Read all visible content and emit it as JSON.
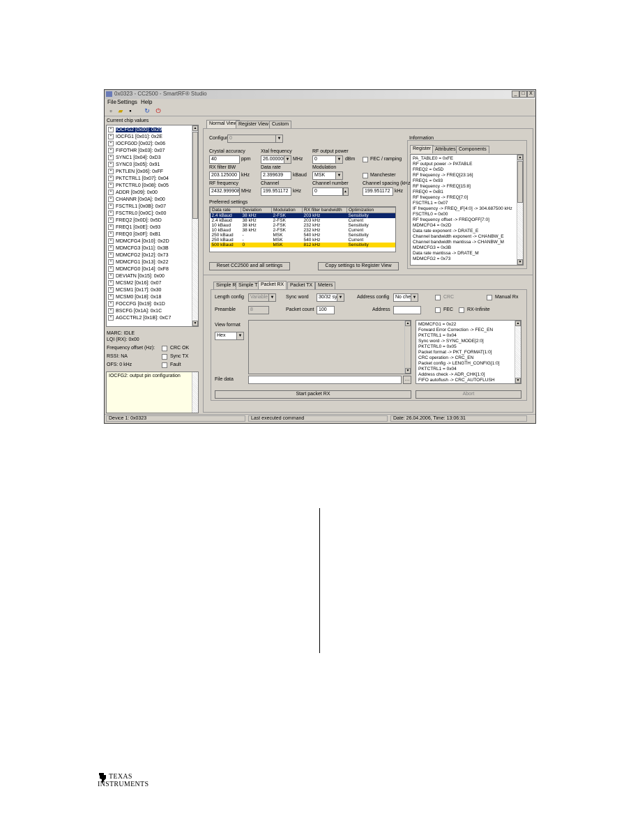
{
  "window": {
    "title": "0x0323 - CC2500 - SmartRF® Studio",
    "min": "_",
    "max": "□",
    "close": "X"
  },
  "menu": [
    "File",
    "Settings",
    "Help"
  ],
  "left": {
    "caption": "Current chip values",
    "tree": [
      "IOCFG2 [0x00]: 0x29",
      "IOCFG1 [0x01]: 0x2E",
      "IOCFG0D [0x02]: 0x06",
      "FIFOTHR [0x03]: 0x07",
      "SYNC1 [0x04]: 0xD3",
      "SYNC0 [0x05]: 0x91",
      "PKTLEN [0x06]: 0xFF",
      "PKTCTRL1 [0x07]: 0x04",
      "PKTCTRL0 [0x08]: 0x05",
      "ADDR [0x09]: 0x00",
      "CHANNR [0x0A]: 0x00",
      "FSCTRL1 [0x0B]: 0x07",
      "FSCTRL0 [0x0C]: 0x00",
      "FREQ2 [0x0D]: 0x5D",
      "FREQ1 [0x0E]: 0x93",
      "FREQ0 [0x0F]: 0xB1",
      "MDMCFG4 [0x10]: 0x2D",
      "MDMCFG3 [0x11]: 0x3B",
      "MDMCFG2 [0x12]: 0x73",
      "MDMCFG1 [0x13]: 0x22",
      "MDMCFG0 [0x14]: 0xF8",
      "DEVIATN [0x15]: 0x00",
      "MCSM2 [0x16]: 0x07",
      "MCSM1 [0x17]: 0x30",
      "MCSM0 [0x18]: 0x18",
      "FOCCFG [0x19]: 0x1D",
      "BSCFG [0x1A]: 0x1C",
      "AGCCTRL2 [0x1B]: 0xC7"
    ],
    "marc": "MARC: IDLE",
    "lqi": "LQI (RX): 0x00",
    "freq_label": "Frequency offset (Hz):",
    "crc_ok": "CRC OK",
    "rssi": "RSSI: NA",
    "sync_tx": "Sync TX",
    "ofs": "OFS: 0 kHz",
    "fault": "Fault",
    "desc": "IOCFG2: output pin configuration"
  },
  "tabs_top": [
    "Normal View",
    "Register View",
    "Custom"
  ],
  "normal": {
    "config_label": "Configuration",
    "config_value": "0",
    "xtal_accuracy_label": "Crystal accuracy",
    "xtal_accuracy": "40",
    "xtal_accuracy_unit": "ppm",
    "xtal_freq_label": "Xtal frequency",
    "xtal_freq": "26.000000",
    "xtal_freq_unit": "MHz",
    "rf_output_label": "RF output power",
    "rf_output": "0",
    "rf_output_unit": "dBm",
    "fec_label": "FEC / ramping",
    "rx_filter_label": "RX filter BW",
    "rx_filter": "203.125000",
    "rx_filter_unit": "kHz",
    "datarate_label": "Data rate",
    "datarate": "2.399639",
    "datarate_unit": "kBaud",
    "modulation_label": "Modulation",
    "modulation": "MSK",
    "manchester_label": "Manchester",
    "freq_label": "RF frequency",
    "freq": "2432.999908",
    "freq_unit": "MHz",
    "channel_label": "Channel",
    "channel": "199.951172",
    "channel_unit": "kHz",
    "channel_number_label": "Channel number",
    "channel_number": "0",
    "chan_spacing_label": "Channel spacing (kHz)",
    "chan_spacing": "199.951172",
    "chan_spacing_unit": "kHz",
    "pref_label": "Preferred settings",
    "pref_headers": [
      "Data rate",
      "Deviation",
      "Modulation",
      "RX filter bandwidth",
      "Optimization"
    ],
    "pref_rows": [
      [
        "2.4 kBaud",
        "38 kHz",
        "2-FSK",
        "203 kHz",
        "Sensitivity"
      ],
      [
        "2.4 kBaud",
        "38 kHz",
        "2-FSK",
        "203 kHz",
        "Current"
      ],
      [
        "10 kBaud",
        "38 kHz",
        "2-FSK",
        "232 kHz",
        "Sensitivity"
      ],
      [
        "10 kBaud",
        "38 kHz",
        "2-FSK",
        "232 kHz",
        "Current"
      ],
      [
        "250 kBaud",
        "-",
        "MSK",
        "540 kHz",
        "Sensitivity"
      ],
      [
        "250 kBaud",
        "-",
        "MSK",
        "540 kHz",
        "Current"
      ],
      [
        "500 kBaud",
        "0",
        "MSK",
        "812 kHz",
        "Sensitivity"
      ]
    ],
    "reset_btn": "Reset CC2500 and all settings",
    "copy_btn": "Copy settings to Register View"
  },
  "info": {
    "caption": "Information",
    "tabs": [
      "Register",
      "Attributes",
      "Components"
    ],
    "lines": [
      "PA_TABLE0 = 0xFE",
      "  RF output power -> PATABLE",
      "FREQ2 = 0x5D",
      "  RF frequency -> FREQ[23:16]",
      "FREQ1 = 0x93",
      "  RF frequency -> FREQ[15:8]",
      "FREQ0 = 0xB1",
      "  RF frequency -> FREQ[7:0]",
      "FSCTRL1 = 0x07",
      "  IF frequency -> FREQ_IF[4:0] -> 304.687500 kHz",
      "FSCTRL0 = 0x00",
      "  RF frequency offset -> FREQOFF[7:0]",
      "MDMCFG4 = 0x2D",
      "  Data rate exponent -> DRATE_E",
      "  Channel bandwidth exponent -> CHANBW_E",
      "  Channel bandwidth mantissa -> CHANBW_M",
      "MDMCFG3 = 0x3B",
      "  Data rate mantissa -> DRATE_M",
      "MDMCFG2 = 0x73"
    ]
  },
  "bottom": {
    "tabs": [
      "Simple RX",
      "Simple TX",
      "Packet RX",
      "Packet TX",
      "Meters"
    ],
    "length_config_label": "Length config",
    "length_config": "Variable",
    "sync_word_label": "Sync word",
    "sync_word": "30/32 sync",
    "addr_config_label": "Address config",
    "addr_config": "No check",
    "crc_label": "CRC",
    "manual_label": "Manual Rx",
    "preamble_label": "Preamble",
    "preamble": "8",
    "packet_count_label": "Packet count",
    "packet_count": "100",
    "address_label": "Address",
    "address": "",
    "fec_label": "FEC",
    "rx_infinite_label": "RX-Infinite",
    "view_format_label": "View format",
    "view_format": "Hex",
    "file_label": "File data",
    "file_value": "",
    "regs": [
      "MDMCFG1 = 0x22",
      "  Forward Error Correction -> FEC_EN",
      "PKTCTRL1 = 0x04",
      "  Sync word -> SYNC_MODE[2:0]",
      "PKTCTRL0 = 0x05",
      "  Packet format -> PKT_FORMAT[1:0]",
      "  CRC operation -> CRC_EN",
      "  Packet config -> LENGTH_CONFIG[1:0]",
      "PKTCTRL1 = 0x04",
      "  Address check -> ADR_CHK[1:0]",
      "  FIFO autoflush -> CRC_AUTOFLUSH"
    ],
    "start_btn": "Start packet RX",
    "stop_btn": "Abort"
  },
  "statusbar": {
    "left": "Device 1: 0x0323",
    "mid": "Last executed command",
    "right": "Date: 26.04.2006, Time: 13:06:31"
  },
  "footer": {
    "logo_line1": "TEXAS",
    "logo_line2": "INSTRUMENTS"
  }
}
